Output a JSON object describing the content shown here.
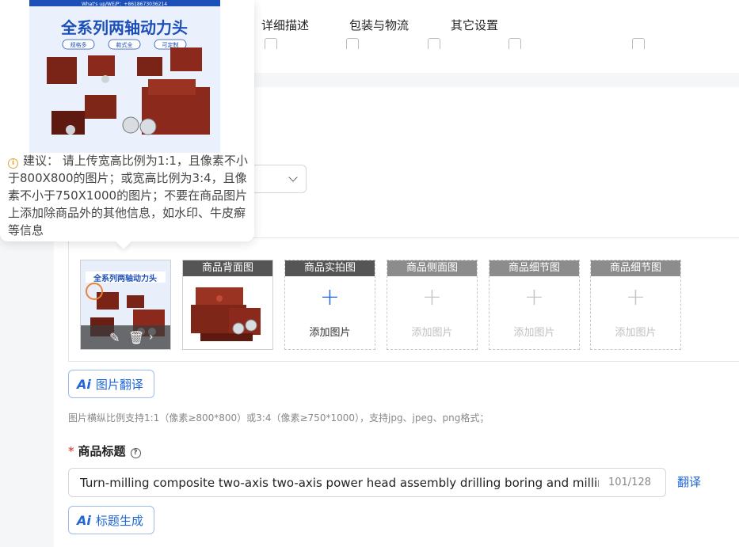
{
  "tabs": [
    {
      "label": "详细描述"
    },
    {
      "label": "包装与物流"
    },
    {
      "label": "其它设置"
    }
  ],
  "preview": {
    "banner_title": "全系列两轴动力头",
    "banner_tags": [
      "规格多",
      "款式全",
      "可定制"
    ],
    "banner_top_text": "What's up/WE/P：+8618673036214"
  },
  "suggestion": {
    "text": "建议： 请上传宽高比例为1:1，且像素不小于800X800的图片；或宽高比例为3:4，且像素不小于750X1000的图片；不要在商品图片上添加除商品外的其他信息，如水印、牛皮癣等信息"
  },
  "image_slots": [
    {
      "title": "",
      "state": "filled"
    },
    {
      "title": "商品背面图",
      "state": "filled"
    },
    {
      "title": "商品实拍图",
      "state": "empty-active",
      "add_label": "添加图片"
    },
    {
      "title": "商品侧面图",
      "state": "empty",
      "add_label": "添加图片"
    },
    {
      "title": "商品细节图",
      "state": "empty",
      "add_label": "添加图片"
    },
    {
      "title": "商品细节图",
      "state": "empty",
      "add_label": "添加图片"
    }
  ],
  "buttons": {
    "image_translate": "图片翻译",
    "title_generate": "标题生成",
    "ai_mark": "Ai"
  },
  "hint": "图片横纵比例支持1:1（像素≥800*800）或3:4（像素≥750*1000），支持jpg、jpeg、png格式；",
  "title_field": {
    "required_mark": "*",
    "label": "商品标题",
    "value": "Turn-milling composite two-axis two-axis power head assembly drilling boring and milling cutter head",
    "count": "101/128",
    "translate": "翻译"
  },
  "colors": {
    "accent": "#1f66d8",
    "required": "#e02020",
    "product_red": "#8b2a1c"
  }
}
